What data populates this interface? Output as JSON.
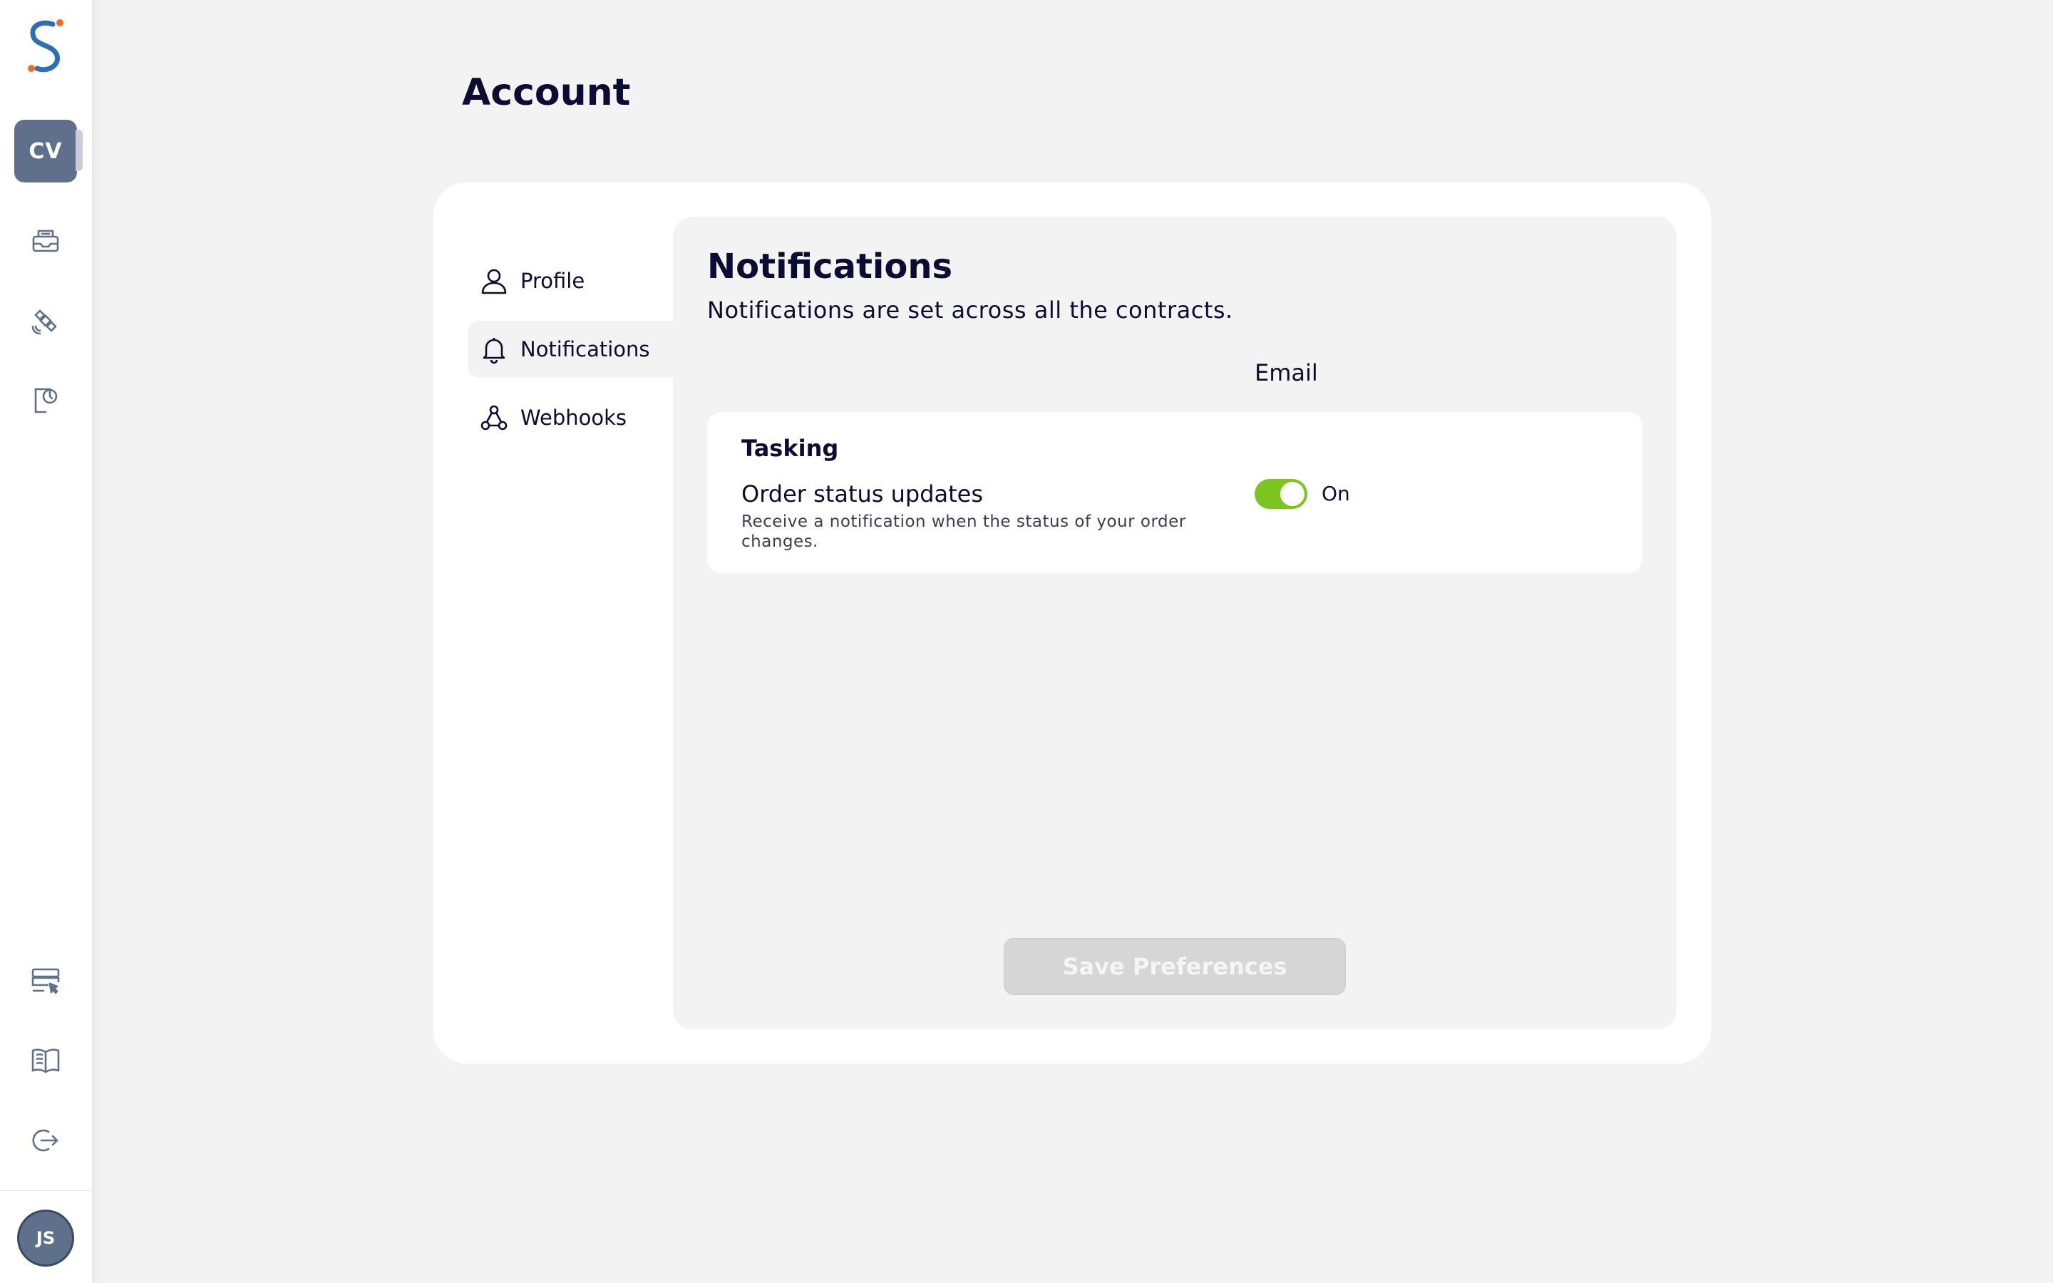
{
  "sidebar": {
    "org_initials": "CV",
    "user_initials": "JS",
    "top_icons": [
      "inbox-icon",
      "satellite-icon",
      "clipboard-clock-icon"
    ],
    "bottom_icons": [
      "server-cursor-icon",
      "book-icon",
      "logout-icon"
    ]
  },
  "page": {
    "title": "Account"
  },
  "menu": {
    "items": [
      {
        "label": "Profile",
        "icon": "user-icon"
      },
      {
        "label": "Notifications",
        "icon": "bell-icon",
        "active": true
      },
      {
        "label": "Webhooks",
        "icon": "webhook-icon"
      }
    ]
  },
  "notifications": {
    "title": "Notifications",
    "subtitle": "Notifications are set across all the contracts.",
    "column_header": "Email",
    "groups": [
      {
        "title": "Tasking",
        "rows": [
          {
            "title": "Order status updates",
            "description": "Receive a notification when the status of your order changes.",
            "email_enabled": true,
            "toggle_label": "On"
          }
        ]
      }
    ],
    "save_label": "Save Preferences"
  },
  "colors": {
    "brand_navy": "#0b0b33",
    "toggle_on": "#7cc520",
    "badge": "#5f708c",
    "logo_blue": "#2d6fb7",
    "logo_orange": "#f26b21"
  }
}
